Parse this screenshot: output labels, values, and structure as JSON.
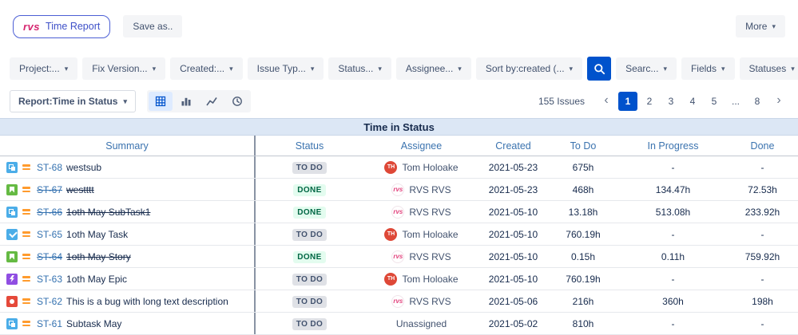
{
  "colors": {
    "accent_blue": "#0052CC",
    "link_blue": "#3572B0",
    "header_blue": "#3B73AF",
    "logo_pink": "#D6246E",
    "badge_todo_bg": "#DFE1E6",
    "badge_todo_text": "#42526E",
    "badge_done_bg": "#E3FCEF",
    "badge_done_text": "#006644",
    "band_bg": "#DCE7F5",
    "priority_orange": "#FF9B2D"
  },
  "top_bar": {
    "logo_text": "rvs",
    "app_button": "Time Report",
    "save_as": "Save as..",
    "more": "More",
    "chevron": "▾"
  },
  "filter_bar": {
    "chevron": "▾",
    "dropdowns": [
      "Project:...",
      "Fix Version...",
      "Created:...",
      "Issue Typ...",
      "Status...",
      "Assignee...",
      "Sort by:created (...",
      "Searc...",
      "Fields",
      "Statuses"
    ]
  },
  "toolbar": {
    "report_selector": "Report:Time in Status",
    "chevron": "▾",
    "issues_count": "155 Issues",
    "pagination": {
      "prev": "‹",
      "next": "›",
      "pages": [
        "1",
        "2",
        "3",
        "4",
        "5",
        "...",
        "8"
      ],
      "current": "1"
    }
  },
  "band_title": "Time in Status",
  "table": {
    "columns": [
      "Summary",
      "Status",
      "Assignee",
      "Created",
      "To Do",
      "In Progress",
      "Done"
    ],
    "rows": [
      {
        "key": "ST-68",
        "type": "subtask",
        "summary": "westsub",
        "resolved": false,
        "status": "TO DO",
        "status_kind": "todo",
        "assignee": "Tom Holoake",
        "avatar": "TH",
        "created": "2021-05-23",
        "todo": "675h",
        "in_progress": "-",
        "done": "-"
      },
      {
        "key": "ST-67",
        "type": "story",
        "summary": "westttt",
        "resolved": true,
        "status": "DONE",
        "status_kind": "done",
        "assignee": "RVS RVS",
        "avatar": "rvs",
        "created": "2021-05-23",
        "todo": "468h",
        "in_progress": "134.47h",
        "done": "72.53h"
      },
      {
        "key": "ST-66",
        "type": "subtask",
        "summary": "1oth May SubTask1",
        "resolved": true,
        "status": "DONE",
        "status_kind": "done",
        "assignee": "RVS RVS",
        "avatar": "rvs",
        "created": "2021-05-10",
        "todo": "13.18h",
        "in_progress": "513.08h",
        "done": "233.92h"
      },
      {
        "key": "ST-65",
        "type": "task",
        "summary": "1oth May Task",
        "resolved": false,
        "status": "TO DO",
        "status_kind": "todo",
        "assignee": "Tom Holoake",
        "avatar": "TH",
        "created": "2021-05-10",
        "todo": "760.19h",
        "in_progress": "-",
        "done": "-"
      },
      {
        "key": "ST-64",
        "type": "story",
        "summary": "1oth May Story",
        "resolved": true,
        "status": "DONE",
        "status_kind": "done",
        "assignee": "RVS RVS",
        "avatar": "rvs",
        "created": "2021-05-10",
        "todo": "0.15h",
        "in_progress": "0.11h",
        "done": "759.92h"
      },
      {
        "key": "ST-63",
        "type": "epic",
        "summary": "1oth May Epic",
        "resolved": false,
        "status": "TO DO",
        "status_kind": "todo",
        "assignee": "Tom Holoake",
        "avatar": "TH",
        "created": "2021-05-10",
        "todo": "760.19h",
        "in_progress": "-",
        "done": "-"
      },
      {
        "key": "ST-62",
        "type": "bug",
        "summary": "This is a bug with long text description",
        "resolved": false,
        "status": "TO DO",
        "status_kind": "todo",
        "assignee": "RVS RVS",
        "avatar": "rvs",
        "created": "2021-05-06",
        "todo": "216h",
        "in_progress": "360h",
        "done": "198h"
      },
      {
        "key": "ST-61",
        "type": "subtask",
        "summary": "Subtask May",
        "resolved": false,
        "status": "TO DO",
        "status_kind": "todo",
        "assignee": "Unassigned",
        "avatar": "",
        "created": "2021-05-02",
        "todo": "810h",
        "in_progress": "-",
        "done": "-"
      }
    ]
  }
}
